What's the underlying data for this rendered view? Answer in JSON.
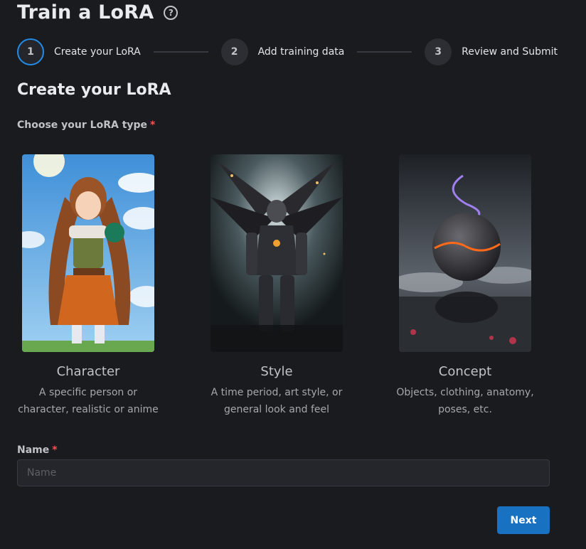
{
  "page": {
    "title": "Train a LoRA",
    "help_icon": "question-circle-icon"
  },
  "stepper": {
    "steps": [
      {
        "number": "1",
        "label": "Create your LoRA",
        "active": true
      },
      {
        "number": "2",
        "label": "Add training data",
        "active": false
      },
      {
        "number": "3",
        "label": "Review and Submit",
        "active": false
      }
    ]
  },
  "section": {
    "title": "Create your LoRA"
  },
  "lora_type": {
    "label": "Choose your LoRA type",
    "required_mark": "*",
    "options": [
      {
        "title": "Character",
        "description": "A specific person or character, realistic or anime"
      },
      {
        "title": "Style",
        "description": "A time period, art style, or general look and feel"
      },
      {
        "title": "Concept",
        "description": "Objects, clothing, anatomy, poses, etc."
      }
    ]
  },
  "name_field": {
    "label": "Name",
    "required_mark": "*",
    "placeholder": "Name",
    "value": ""
  },
  "actions": {
    "next_label": "Next"
  },
  "colors": {
    "background": "#1a1b1e",
    "accent": "#228be6",
    "button": "#1971c2",
    "required": "#fa5252"
  }
}
